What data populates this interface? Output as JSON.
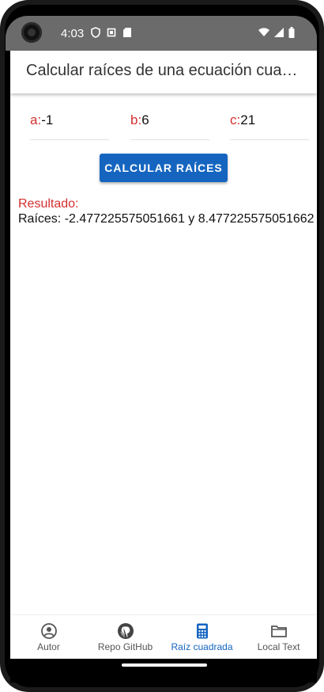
{
  "status_bar": {
    "time": "4:03",
    "left_icons": [
      "shield-icon",
      "screen-record-icon",
      "sd-card-icon"
    ],
    "right_icons": [
      "wifi-icon",
      "signal-icon",
      "battery-icon"
    ]
  },
  "app_bar": {
    "title": "Calcular raíces de una ecuación cuadrática"
  },
  "inputs": [
    {
      "label": "a:",
      "value": "-1"
    },
    {
      "label": "b:",
      "value": "6"
    },
    {
      "label": "c:",
      "value": "21"
    }
  ],
  "calculate_button": {
    "label": "CALCULAR RAÍCES"
  },
  "result": {
    "label": "Resultado:",
    "text": "Raíces: -2.477225575051661 y 8.477225575051662"
  },
  "bottom_nav": {
    "items": [
      {
        "label": "Autor",
        "icon": "account-circle-icon",
        "active": false
      },
      {
        "label": "Repo GitHub",
        "icon": "github-icon",
        "active": false
      },
      {
        "label": "Raíz cuadrada",
        "icon": "calculator-icon",
        "active": true
      },
      {
        "label": "Local Text",
        "icon": "folder-icon",
        "active": false
      }
    ]
  },
  "colors": {
    "accent": "#1565c0",
    "label_red": "#d32f2f",
    "status_bar": "#6b6b6b"
  }
}
